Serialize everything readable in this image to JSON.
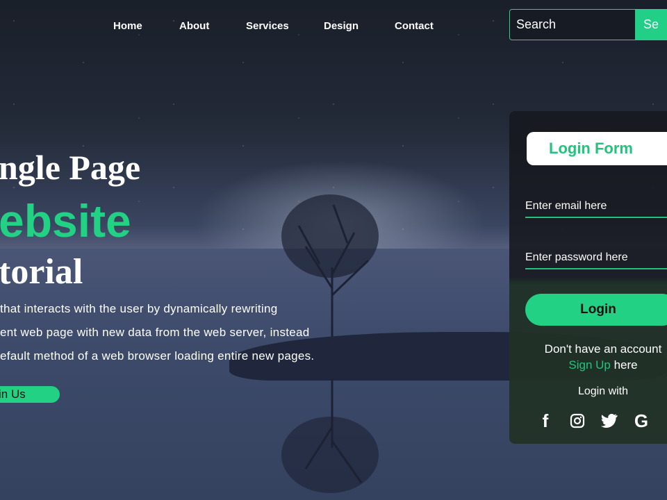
{
  "nav": {
    "items": [
      "Home",
      "About",
      "Services",
      "Design",
      "Contact"
    ]
  },
  "search": {
    "placeholder": "Search",
    "button": "Se"
  },
  "hero": {
    "line1": "ngle Page",
    "line2": "ebsite",
    "line3": "torial",
    "desc": [
      "that interacts with the user by dynamically rewriting",
      "ent web page with new data from the web server, instead",
      "efault method of a web browser loading entire new pages."
    ],
    "join": "in Us",
    "accent": "#22d184"
  },
  "login": {
    "title": "Login Form",
    "email_placeholder": "Enter email here",
    "password_placeholder": "Enter password here",
    "button": "Login",
    "no_account": "Don't have an account",
    "signup": "Sign Up",
    "here": "here",
    "login_with": "Login with",
    "social": [
      "facebook-icon",
      "instagram-icon",
      "twitter-icon",
      "google-icon",
      "skype-icon"
    ]
  }
}
